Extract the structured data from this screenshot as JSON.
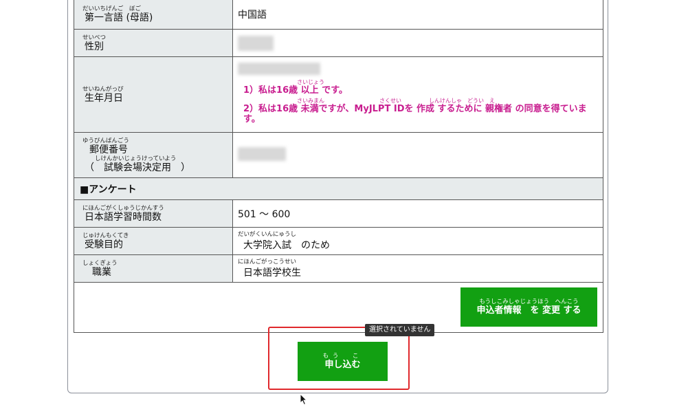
{
  "form": {
    "rows": {
      "language": {
        "ruby": "だいいちげんご　ぼご",
        "label": "第一言語 (母語)",
        "value": "中国語"
      },
      "gender": {
        "ruby": "せいべつ",
        "label": "性別"
      },
      "birthdate": {
        "ruby": "せいねんがっぴ",
        "label": "生年月日",
        "option1": "1）私は16歳 以上 です。",
        "option1_ruby": "さいじょう",
        "option2": "2）私は16歳 未満ですが、MyJLPT IDを 作成 するために 親権者 の同意を得ています。",
        "option2_ruby": "さいみまん　　　　　　　　　　さくせい　　　　　しんけんしゃ　どうい　え"
      },
      "postal": {
        "ruby1": "ゆうびんばんごう",
        "label1": "郵便番号",
        "ruby2": "しけんかいじょうけっていよう",
        "label2": "（　試験会場決定用　）"
      },
      "survey_header": "■アンケート",
      "study_hours": {
        "ruby": "にほんごがくしゅうじかんすう",
        "label": "日本語学習時間数",
        "value": "501 〜 600"
      },
      "purpose": {
        "ruby": "じゅけんもくてき",
        "label": "受験目的",
        "value_ruby": "だいがくいんにゅうし",
        "value": "大学院入試　のため"
      },
      "occupation": {
        "ruby": "しょくぎょう",
        "label": "職業",
        "value_ruby": "にほんごがっこうせい",
        "value": "日本語学校生"
      }
    }
  },
  "buttons": {
    "change": {
      "ruby": "もうしこみしゃじょうほう　へんこう",
      "label": "申込者情報　を 変更 する"
    },
    "submit": {
      "ruby": "もう　こ",
      "label": "申し込む"
    }
  },
  "tooltip": "選択されていません",
  "colors": {
    "accent": "#12a012",
    "warning": "#c81d8f",
    "highlight_box": "#e0282c",
    "label_bg": "#e7ebec"
  }
}
